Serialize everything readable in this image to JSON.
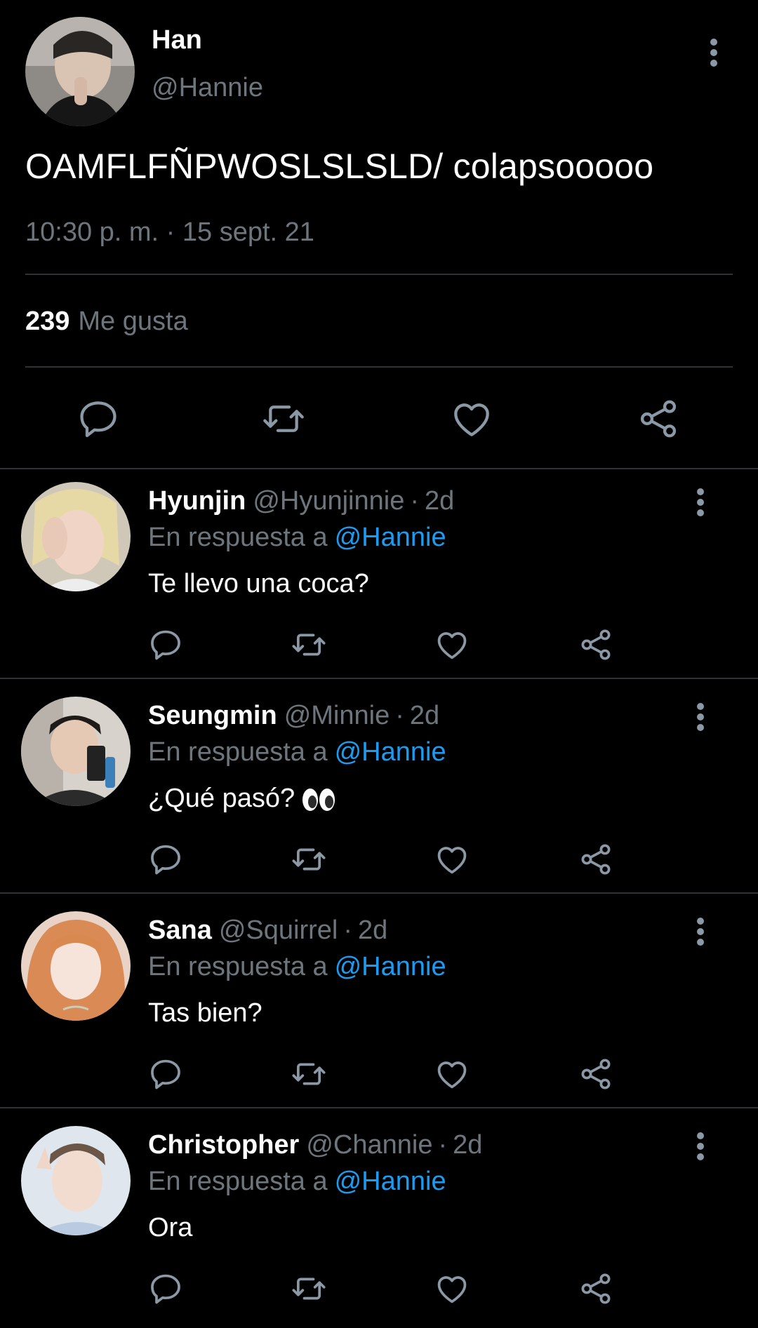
{
  "main_tweet": {
    "display_name": "Han",
    "handle": "@Hannie",
    "text": "OAMFLFÑPWOSLSLSLD/ colapsooooo",
    "timestamp": "10:30 p. m. · 15 sept. 21",
    "likes_count": "239",
    "likes_label": "Me gusta",
    "icons": [
      "more-icon",
      "reply-icon",
      "retweet-icon",
      "like-icon",
      "share-icon"
    ]
  },
  "replies": [
    {
      "display_name": "Hyunjin",
      "handle": "@Hyunjinnie",
      "separator": "·",
      "time": "2d",
      "reply_prefix": "En respuesta a",
      "reply_handle": "@Hannie",
      "text": "Te llevo una coca?"
    },
    {
      "display_name": "Seungmin",
      "handle": "@Minnie",
      "separator": "·",
      "time": "2d",
      "reply_prefix": "En respuesta a",
      "reply_handle": "@Hannie",
      "text": "¿Qué pasó?",
      "emoji": "eyes-emoji"
    },
    {
      "display_name": "Sana",
      "handle": "@Squirrel",
      "separator": "·",
      "time": "2d",
      "reply_prefix": "En respuesta a",
      "reply_handle": "@Hannie",
      "text": "Tas bien?"
    },
    {
      "display_name": "Christopher",
      "handle": "@Channie",
      "separator": "·",
      "time": "2d",
      "reply_prefix": "En respuesta a",
      "reply_handle": "@Hannie",
      "text": "Ora"
    }
  ],
  "colors": {
    "background": "#000000",
    "text": "#ffffff",
    "secondary_text": "#6e767d",
    "link": "#1d9bf0",
    "divider": "#2f3336",
    "icon": "#8b98a5"
  }
}
